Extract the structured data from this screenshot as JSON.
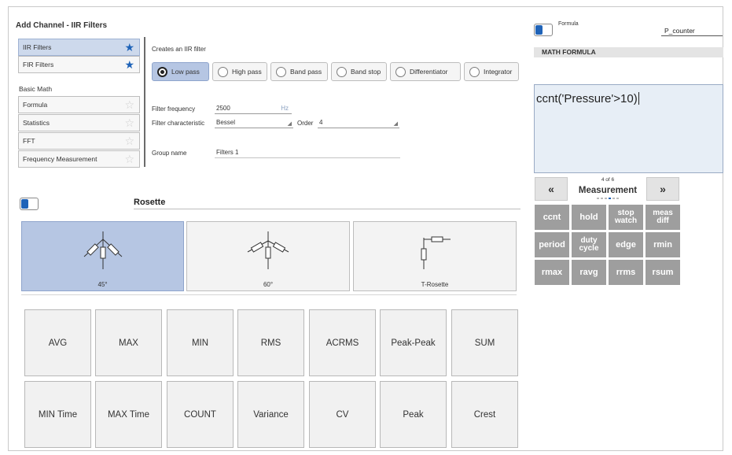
{
  "window": {
    "title": "Add Channel - IIR Filters"
  },
  "sidebar": {
    "top_items": [
      {
        "label": "IIR Filters",
        "starred": true,
        "selected": true
      },
      {
        "label": "FIR Filters",
        "starred": true,
        "selected": false
      }
    ],
    "group_label": "Basic Math",
    "group_items": [
      {
        "label": "Formula",
        "starred": false
      },
      {
        "label": "Statistics",
        "starred": false
      },
      {
        "label": "FFT",
        "starred": false
      },
      {
        "label": "Frequency Measurement",
        "starred": false
      }
    ]
  },
  "filter": {
    "description": "Creates an IIR filter",
    "types": [
      {
        "label": "Low pass",
        "selected": true
      },
      {
        "label": "High pass",
        "selected": false
      },
      {
        "label": "Band pass",
        "selected": false
      },
      {
        "label": "Band stop",
        "selected": false
      },
      {
        "label": "Differentiator",
        "selected": false
      },
      {
        "label": "Integrator",
        "selected": false
      }
    ],
    "frequency_label": "Filter frequency",
    "frequency_value": "2500",
    "frequency_unit": "Hz",
    "characteristic_label": "Filter characteristic",
    "characteristic_value": "Bessel",
    "order_label": "Order",
    "order_value": "4",
    "group_name_label": "Group name",
    "group_name_value": "Filters 1"
  },
  "rosette": {
    "title": "Rosette",
    "tiles": [
      {
        "label": "45°",
        "selected": true
      },
      {
        "label": "60°",
        "selected": false
      },
      {
        "label": "T-Rosette",
        "selected": false
      }
    ]
  },
  "functions": [
    "AVG",
    "MAX",
    "MIN",
    "RMS",
    "ACRMS",
    "Peak-Peak",
    "SUM",
    "MIN Time",
    "MAX Time",
    "COUNT",
    "Variance",
    "CV",
    "Peak",
    "Crest"
  ],
  "formula_panel": {
    "formula_label": "Formula",
    "channel_name": "P_counter",
    "header": "MATH FORMULA",
    "expression": "ccnt('Pressure'>10)",
    "pager": {
      "position": "4 of 6",
      "current": "Measurement",
      "prev": "«",
      "next": "»",
      "page": 4,
      "total": 6
    },
    "buttons": [
      [
        "ccnt"
      ],
      [
        "hold"
      ],
      [
        "stop",
        "watch"
      ],
      [
        "meas",
        "diff"
      ],
      [
        "period"
      ],
      [
        "duty",
        "cycle"
      ],
      [
        "edge"
      ],
      [
        "rmin"
      ],
      [
        "rmax"
      ],
      [
        "ravg"
      ],
      [
        "rrms"
      ],
      [
        "rsum"
      ]
    ]
  },
  "colors": {
    "accent": "#1f63b8",
    "selected_bg": "#b6c6e3",
    "formula_bg": "#e7eef6",
    "math_button": "#9e9e9e"
  }
}
